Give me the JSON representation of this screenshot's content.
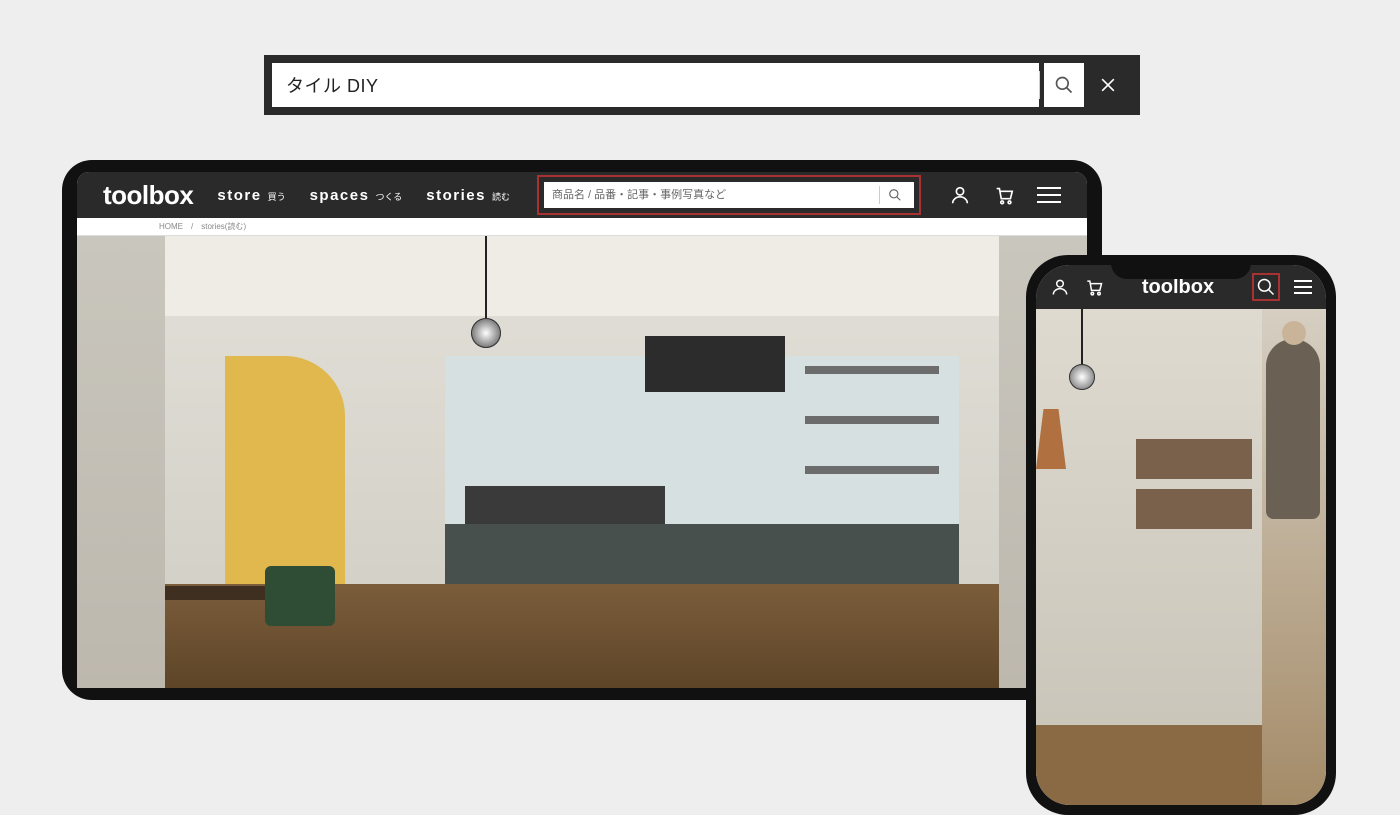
{
  "top_search": {
    "value": "タイル DIY"
  },
  "laptop": {
    "logo": "toolbox",
    "nav": [
      {
        "label": "store",
        "sub": "買う"
      },
      {
        "label": "spaces",
        "sub": "つくる"
      },
      {
        "label": "stories",
        "sub": "読む"
      }
    ],
    "search_placeholder": "商品名 / 品番・記事・事例写真など",
    "breadcrumb": {
      "home": "HOME",
      "sep": "/",
      "current": "stories(読む)"
    }
  },
  "phone": {
    "logo": "toolbox"
  },
  "colors": {
    "dark": "#2a2a2a",
    "highlight": "#a83232"
  }
}
